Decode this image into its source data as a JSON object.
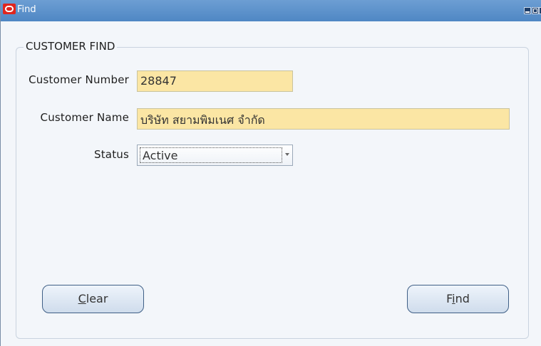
{
  "window": {
    "title": "Find"
  },
  "group": {
    "title": "CUSTOMER FIND"
  },
  "fields": {
    "customer_number": {
      "label": "Customer Number",
      "value": "28847"
    },
    "customer_name": {
      "label": "Customer Name",
      "value": "บริษัท สยามพิมเนศ จำกัด"
    },
    "status": {
      "label": "Status",
      "value": "Active"
    }
  },
  "buttons": {
    "clear": {
      "mnemonic": "C",
      "rest": "lear"
    },
    "find": {
      "pre": "F",
      "mnemonic": "i",
      "rest": "nd"
    }
  },
  "colors": {
    "titlebar": "#5a90cc",
    "field_bg": "#fbe6a4",
    "window_bg": "#f3f6fa"
  }
}
